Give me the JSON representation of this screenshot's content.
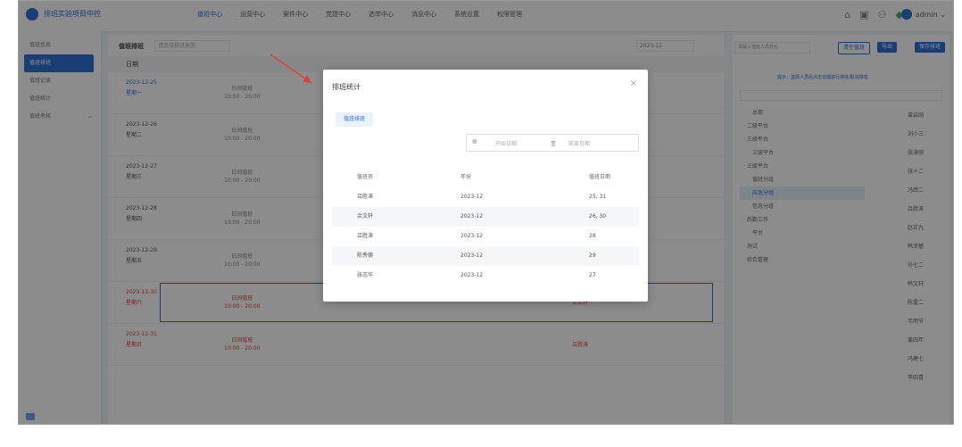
{
  "app": {
    "title": "排班实验项目中控"
  },
  "nav": [
    "值班中心",
    "运营中心",
    "案件中心",
    "党建中心",
    "选举中心",
    "消息中心",
    "系统设置",
    "权限管理"
  ],
  "user": {
    "name": "admin ⌄"
  },
  "top_icons": [
    "home-icon",
    "calendar-icon",
    "user-icon",
    "bell-icon"
  ],
  "sidebar": {
    "items": [
      {
        "label": "值班信息"
      },
      {
        "label": "值班排班",
        "active": true
      },
      {
        "label": "值班记录"
      },
      {
        "label": "值班统计"
      },
      {
        "label": "值班考核",
        "chevron": "⌄"
      }
    ]
  },
  "main": {
    "tab_title": "值班排班",
    "filter_placeholder": "请选择排班类型",
    "date_filter": "2023-12",
    "column_header": "日期",
    "rows": [
      {
        "date": "2023-12-25",
        "weekday": "星期一",
        "shift": "日间值班",
        "time": "10:00 - 20:00",
        "person": "",
        "color": "blue"
      },
      {
        "date": "2023-12-26",
        "weekday": "星期二",
        "shift": "日间值班",
        "time": "10:00 - 20:00",
        "person": "",
        "color": "dark"
      },
      {
        "date": "2023-12-27",
        "weekday": "星期三",
        "shift": "日间值班",
        "time": "10:00 - 20:00",
        "person": "",
        "color": "dark"
      },
      {
        "date": "2023-12-28",
        "weekday": "星期四",
        "shift": "日间值班",
        "time": "10:00 - 20:00",
        "person": "韩沛基",
        "color": "dark"
      },
      {
        "date": "2023-12-29",
        "weekday": "星期五",
        "shift": "日间值班",
        "time": "10:00 - 20:00",
        "person": "吕胜涛",
        "color": "dark"
      },
      {
        "date": "2023-12-30",
        "weekday": "星期六",
        "shift": "日间值班",
        "time": "10:00 - 20:00",
        "person": "余文轩",
        "color": "red"
      },
      {
        "date": "2023-12-31",
        "weekday": "星期日",
        "shift": "日间值班",
        "time": "10:00 - 20:00",
        "person": "吕胜涛",
        "color": "red"
      }
    ]
  },
  "right_panel": {
    "search_placeholder": "请输入值班人员姓名",
    "btn_clear": "清空值班",
    "btn_export": "导出",
    "btn_save": "保存排班",
    "hint": "提示：选择人员后点击日期进行排班/取消排班",
    "tree": [
      "总部",
      "· 二级平台",
      "· 三级平台",
      "三级平台",
      "· 三级平台",
      "值班分组",
      "应急分组",
      "信息分组",
      "· 后勤工作",
      "平台",
      "· 测试",
      "· 综合管理"
    ],
    "selected_tree_index": 6,
    "people": [
      "曾启刚",
      "刘小三",
      "张涛刚",
      "张十二",
      "冯西二",
      "吕胜涛",
      "赵正九",
      "韩沛基",
      "孙七二",
      "韩文轩",
      "陈雷二",
      "韦明节",
      "姜四年",
      "冯建七",
      "李四喜"
    ]
  },
  "modal": {
    "title": "排班统计",
    "close_glyph": "×",
    "button": "值班排班",
    "date_start_placeholder": "开始日期",
    "date_sep": "至",
    "date_end_placeholder": "结束日期",
    "calendar_glyph": "▦",
    "columns": [
      "值班员",
      "年份",
      "值班日期"
    ],
    "rows": [
      [
        "吕胜涛",
        "2023-12",
        "25, 31"
      ],
      [
        "余文轩",
        "2023-12",
        "26, 30"
      ],
      [
        "吕胜涛",
        "2023-12",
        "28"
      ],
      [
        "陈秀德",
        "2023-12",
        "29"
      ],
      [
        "张志华",
        "2023-12",
        "27"
      ]
    ]
  },
  "colors": {
    "accent": "#2f6fd6",
    "overlay": "rgba(0,0,0,0.45)",
    "arrow": "#e0403a"
  }
}
